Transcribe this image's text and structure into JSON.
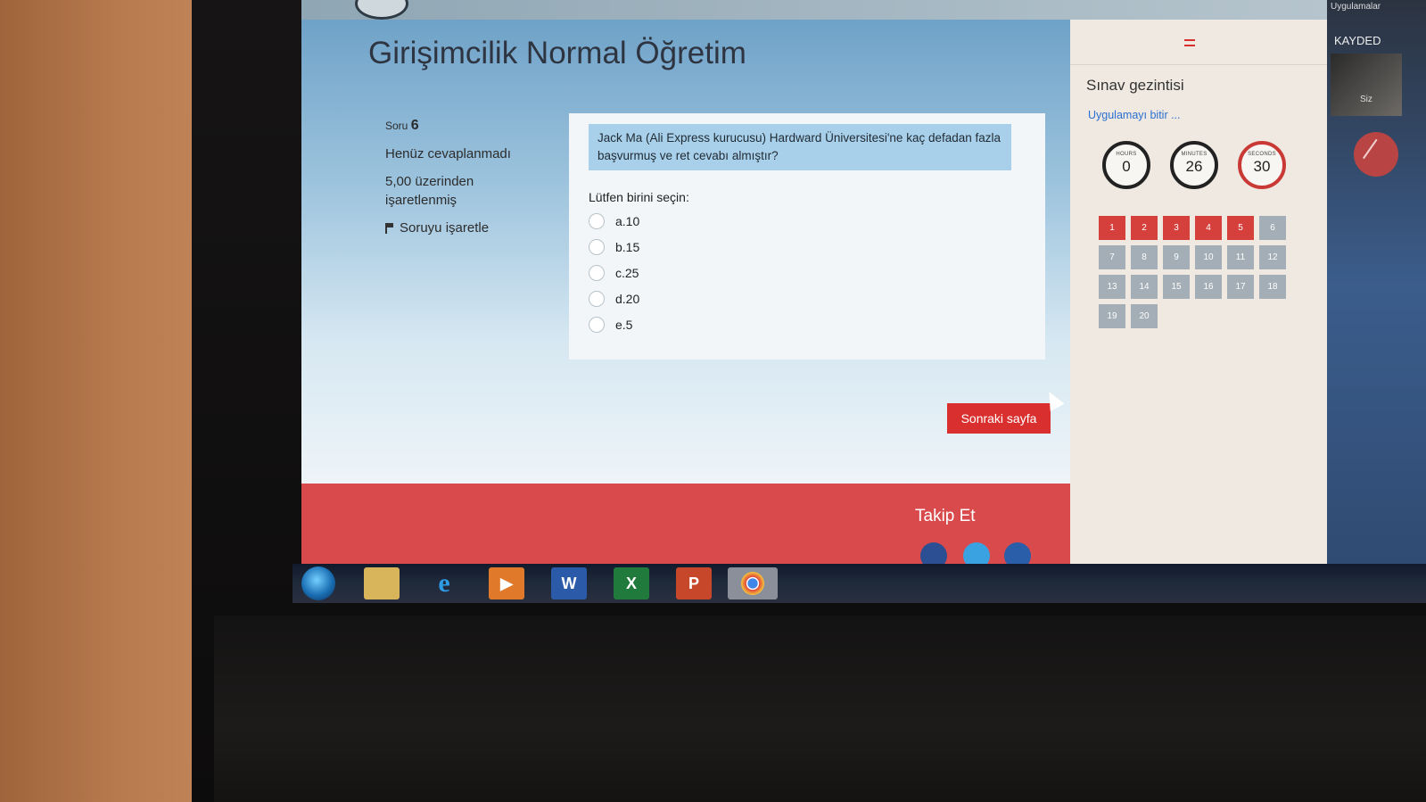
{
  "course": {
    "title": "Girişimcilik Normal Öğretim"
  },
  "question_info": {
    "number_prefix": "Soru",
    "number": "6",
    "state": "Henüz cevaplanmadı",
    "grade": "5,00 üzerinden işaretlenmiş",
    "flag_label": "Soruyu işaretle"
  },
  "question": {
    "text": "Jack Ma (Ali Express kurucusu) Hardward Üniversitesi'ne kaç defadan fazla başvurmuş ve ret cevabı almıştır?",
    "prompt": "Lütfen birini seçin:",
    "options": [
      "a.10",
      "b.15",
      "c.25",
      "d.20",
      "e.5"
    ]
  },
  "next_button": "Sonraki sayfa",
  "footer": {
    "follow": "Takip Et"
  },
  "navigation": {
    "title": "Sınav gezintisi",
    "finish_link": "Uygulamayı bitir ...",
    "timer": {
      "hours_label": "HOURS",
      "hours": "0",
      "minutes_label": "MINUTES",
      "minutes": "26",
      "seconds_label": "SECONDS",
      "seconds": "30"
    },
    "questions": [
      "1",
      "2",
      "3",
      "4",
      "5",
      "6",
      "7",
      "8",
      "9",
      "10",
      "11",
      "12",
      "13",
      "14",
      "15",
      "16",
      "17",
      "18",
      "19",
      "20"
    ],
    "answered_count": 5
  },
  "meeting": {
    "apps_label": "Uygulamalar",
    "record_label": "KAYDED",
    "self_label": "Siz"
  },
  "colors": {
    "accent_red": "#d9302f",
    "question_bg": "#a9d0ea",
    "link_blue": "#2a6fd1"
  },
  "taskbar_icons": [
    "windows-start-icon",
    "file-explorer-icon",
    "internet-explorer-icon",
    "media-player-icon",
    "word-icon",
    "excel-icon",
    "powerpoint-icon",
    "chrome-icon"
  ]
}
